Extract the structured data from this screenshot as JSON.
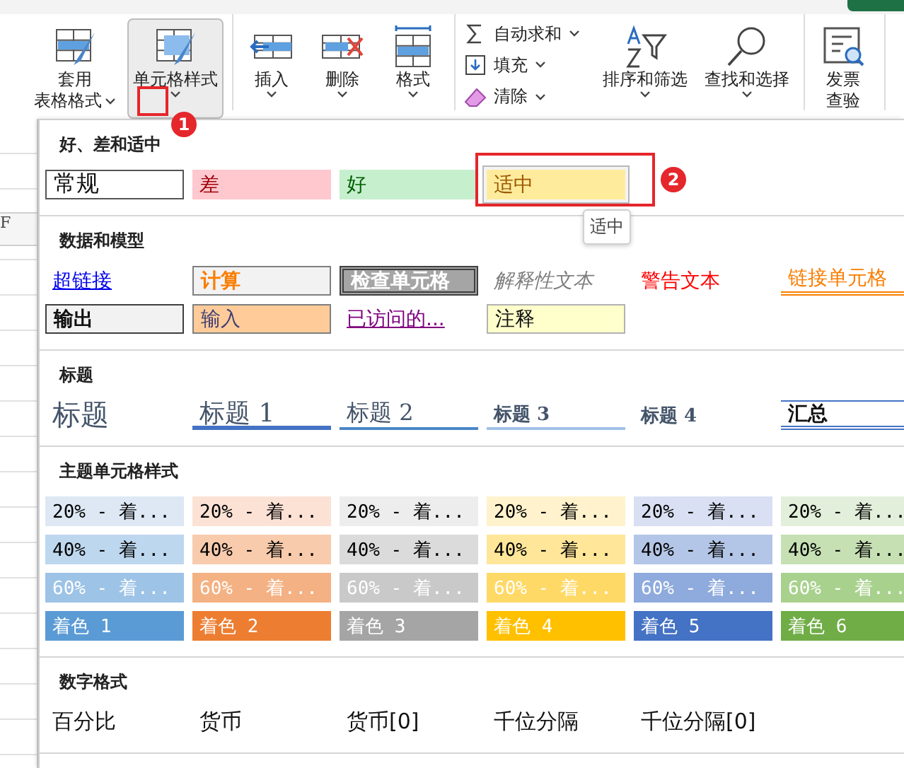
{
  "ribbon": {
    "groups": [
      {
        "buttons": [
          {
            "kind": "big",
            "lines": [
              "套用",
              "表格格式"
            ],
            "dropdown": true,
            "selected": false
          },
          {
            "kind": "big",
            "lines": [
              "单元格样式"
            ],
            "dropdown": true,
            "selected": true
          }
        ]
      },
      {
        "buttons": [
          {
            "kind": "big",
            "lines": [
              "插入"
            ],
            "dropdown": true,
            "selected": false
          },
          {
            "kind": "big",
            "lines": [
              "删除"
            ],
            "dropdown": true,
            "selected": false
          },
          {
            "kind": "big",
            "lines": [
              "格式"
            ],
            "dropdown": true,
            "selected": false
          }
        ]
      },
      {
        "buttons": [
          {
            "kind": "stack",
            "items": [
              {
                "label": "自动求和"
              },
              {
                "label": "填充"
              },
              {
                "label": "清除"
              }
            ]
          },
          {
            "kind": "big",
            "lines": [
              "排序和筛选"
            ],
            "dropdown": true,
            "selected": false
          },
          {
            "kind": "big",
            "lines": [
              "查找和选择"
            ],
            "dropdown": true,
            "selected": false
          }
        ]
      },
      {
        "buttons": [
          {
            "kind": "big",
            "lines": [
              "发票",
              "查验"
            ],
            "dropdown": false,
            "selected": false
          }
        ]
      }
    ]
  },
  "sheet": {
    "column_header": "F"
  },
  "gallery": {
    "sections": [
      {
        "title": "好、差和适中",
        "items": [
          {
            "label": "常规",
            "kind": "normal",
            "selected": false
          },
          {
            "label": "差",
            "kind": "bad",
            "selected": false
          },
          {
            "label": "好",
            "kind": "good",
            "selected": false
          },
          {
            "label": "适中",
            "kind": "neutral",
            "selected": true
          }
        ]
      },
      {
        "title": "数据和模型",
        "items": [
          {
            "label": "超链接",
            "kind": "hyperlink",
            "selected": false
          },
          {
            "label": "计算",
            "kind": "calculation",
            "selected": false
          },
          {
            "label": "检查单元格",
            "kind": "check",
            "selected": false
          },
          {
            "label": "解释性文本",
            "kind": "explanatory",
            "selected": false
          },
          {
            "label": "警告文本",
            "kind": "warning",
            "selected": false
          },
          {
            "label": "链接单元格",
            "kind": "linked",
            "selected": false
          },
          {
            "label": "输出",
            "kind": "output",
            "selected": false
          },
          {
            "label": "输入",
            "kind": "input",
            "selected": false
          },
          {
            "label": "已访问的...",
            "kind": "followed",
            "selected": false
          },
          {
            "label": "注释",
            "kind": "note",
            "selected": false
          }
        ]
      },
      {
        "title": "标题",
        "items": [
          {
            "label": "标题",
            "kind": "title",
            "selected": false
          },
          {
            "label": "标题 1",
            "kind": "heading1",
            "selected": false
          },
          {
            "label": "标题 2",
            "kind": "heading2",
            "selected": false
          },
          {
            "label": "标题 3",
            "kind": "heading3",
            "selected": false
          },
          {
            "label": "标题 4",
            "kind": "heading4",
            "selected": false
          },
          {
            "label": "汇总",
            "kind": "total",
            "selected": false
          }
        ]
      },
      {
        "title": "主题单元格样式",
        "items": [
          {
            "label": "20% - 着...",
            "kind": "pale",
            "color": "#dde8f4",
            "selected": false
          },
          {
            "label": "20% - 着...",
            "kind": "pale",
            "color": "#fbe2d5",
            "selected": false
          },
          {
            "label": "20% - 着...",
            "kind": "pale",
            "color": "#ededed",
            "selected": false
          },
          {
            "label": "20% - 着...",
            "kind": "pale",
            "color": "#fff2cc",
            "selected": false
          },
          {
            "label": "20% - 着...",
            "kind": "pale",
            "color": "#d9e0f3",
            "selected": false
          },
          {
            "label": "20% - 着...",
            "kind": "pale",
            "color": "#e2efda",
            "selected": false
          },
          {
            "label": "40% - 着...",
            "kind": "pale",
            "color": "#bdd7ee",
            "selected": false
          },
          {
            "label": "40% - 着...",
            "kind": "pale",
            "color": "#f8cbad",
            "selected": false
          },
          {
            "label": "40% - 着...",
            "kind": "pale",
            "color": "#dbdbdb",
            "selected": false
          },
          {
            "label": "40% - 着...",
            "kind": "pale",
            "color": "#ffe699",
            "selected": false
          },
          {
            "label": "40% - 着...",
            "kind": "pale",
            "color": "#b4c6e7",
            "selected": false
          },
          {
            "label": "40% - 着...",
            "kind": "pale",
            "color": "#c6e0b4",
            "selected": false
          },
          {
            "label": "60% - 着...",
            "kind": "strong",
            "color": "#9dc3e6",
            "selected": false
          },
          {
            "label": "60% - 着...",
            "kind": "strong",
            "color": "#f4b183",
            "selected": false
          },
          {
            "label": "60% - 着...",
            "kind": "strong",
            "color": "#c9c9c9",
            "selected": false
          },
          {
            "label": "60% - 着...",
            "kind": "strong",
            "color": "#ffd966",
            "selected": false
          },
          {
            "label": "60% - 着...",
            "kind": "strong",
            "color": "#8faadc",
            "selected": false
          },
          {
            "label": "60% - 着...",
            "kind": "strong",
            "color": "#a9d18e",
            "selected": false
          },
          {
            "label": "着色 1",
            "kind": "strong",
            "color": "#5b9bd5",
            "selected": false
          },
          {
            "label": "着色 2",
            "kind": "strong",
            "color": "#ed7d31",
            "selected": false
          },
          {
            "label": "着色 3",
            "kind": "strong",
            "color": "#a5a5a5",
            "selected": false
          },
          {
            "label": "着色 4",
            "kind": "strong",
            "color": "#ffc000",
            "selected": false
          },
          {
            "label": "着色 5",
            "kind": "strong",
            "color": "#4472c4",
            "selected": false
          },
          {
            "label": "着色 6",
            "kind": "strong",
            "color": "#70ad47",
            "selected": false
          }
        ]
      },
      {
        "title": "数字格式",
        "items": [
          {
            "label": "百分比",
            "kind": "number",
            "selected": false
          },
          {
            "label": "货币",
            "kind": "number",
            "selected": false
          },
          {
            "label": "货币[0]",
            "kind": "number",
            "selected": false
          },
          {
            "label": "千位分隔",
            "kind": "number",
            "selected": false
          },
          {
            "label": "千位分隔[0]",
            "kind": "number",
            "selected": false
          }
        ]
      }
    ]
  },
  "tooltip": "适中",
  "annotations": [
    {
      "label": "1"
    },
    {
      "label": "2"
    }
  ]
}
